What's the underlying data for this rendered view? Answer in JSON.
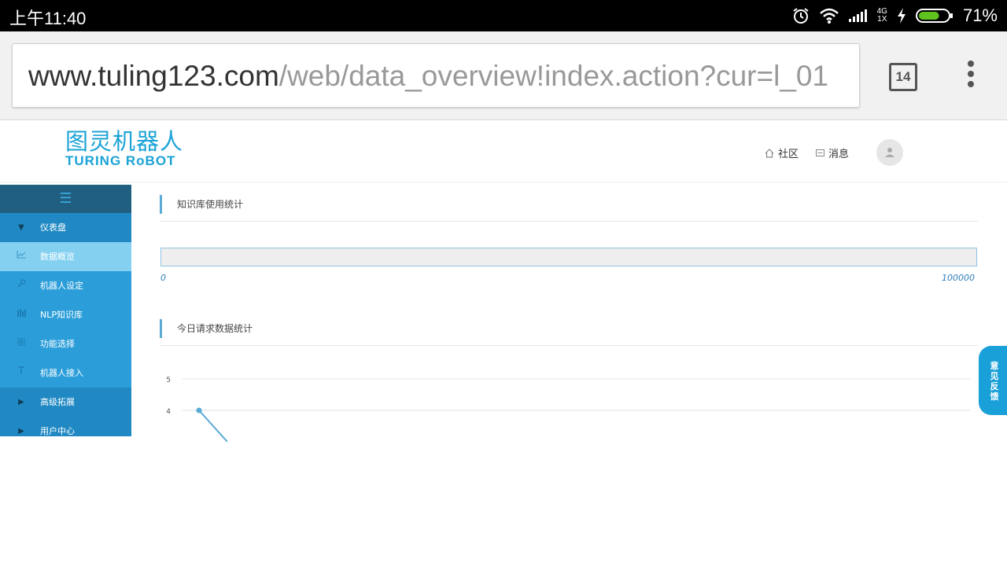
{
  "status_bar": {
    "time": "上午11:40",
    "network_top": "4G",
    "network_bottom": "1X",
    "battery_percent": "71%",
    "battery_level": 0.71,
    "icons": [
      "alarm-icon",
      "wifi-icon",
      "signal-icon",
      "charging-icon",
      "battery-icon"
    ]
  },
  "browser": {
    "url_host": "www.tuling123.com",
    "url_path": "/web/data_overview!index.action?cur=l_01",
    "tab_count": "14",
    "menu_icon": "overflow-menu-icon"
  },
  "header": {
    "logo_cn": "图灵机器人",
    "logo_en": "TURING RoBOT",
    "community_label": "社区",
    "messages_label": "消息",
    "avatar_icon": "user-icon"
  },
  "sidebar": {
    "toggle_icon": "hamburger-icon",
    "items": [
      {
        "label": "仪表盘",
        "icon": "caret-down-icon",
        "state": "group"
      },
      {
        "label": "数据概览",
        "icon": "chart-icon",
        "state": "active"
      },
      {
        "label": "机器人设定",
        "icon": "wrench-icon",
        "state": "normal"
      },
      {
        "label": "NLP知识库",
        "icon": "bars-icon",
        "state": "normal"
      },
      {
        "label": "功能选择",
        "icon": "grid-icon",
        "state": "normal"
      },
      {
        "label": "机器人接入",
        "icon": "plug-icon",
        "state": "normal"
      },
      {
        "label": "高级拓展",
        "icon": "caret-right-icon",
        "state": "group"
      },
      {
        "label": "用户中心",
        "icon": "caret-right-icon",
        "state": "group"
      }
    ]
  },
  "knowledge_section": {
    "title": "知识库使用统计",
    "range_min": "0",
    "range_max": "100000",
    "used_fraction": 0
  },
  "requests_section": {
    "title": "今日请求数据统计"
  },
  "chart_data": {
    "type": "line",
    "title": "",
    "xlabel": "",
    "ylabel": "",
    "y_ticks": [
      "5",
      "4"
    ],
    "grid": true,
    "series": [
      {
        "points": [
          {
            "x": 0,
            "y": 4
          },
          {
            "x": 1,
            "y": 3
          }
        ]
      }
    ]
  },
  "feedback": {
    "label": "意见反馈"
  },
  "colors": {
    "brand": "#1aa3d6",
    "sidebar": "#2b9ed9",
    "sidebar_active": "#83d0f1",
    "sidebar_group": "#2089c4",
    "sidebar_toggle": "#215f80",
    "chart_line": "#5aaad7",
    "battery_fill": "#5fc21f"
  }
}
